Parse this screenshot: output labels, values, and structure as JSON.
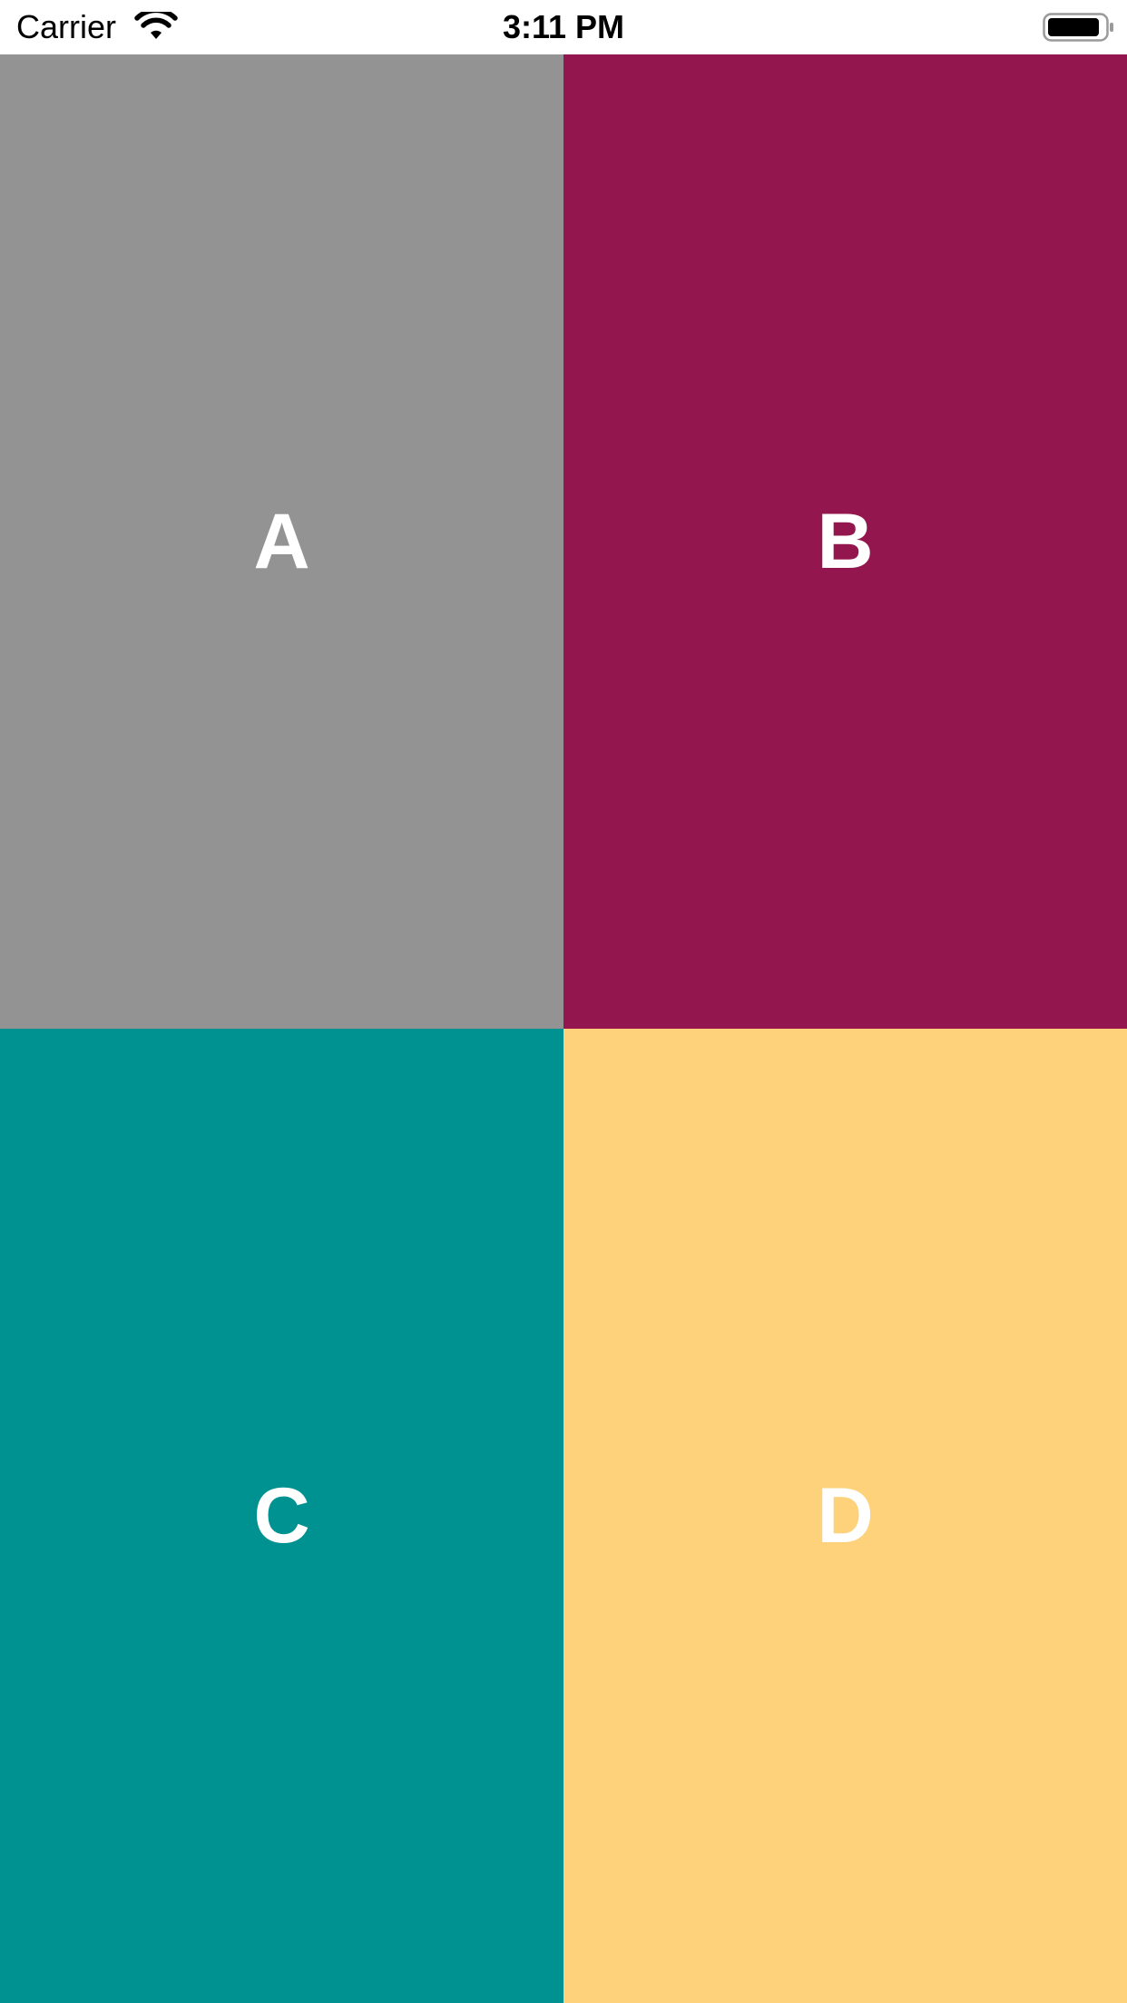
{
  "status_bar": {
    "carrier": "Carrier",
    "time": "3:11 PM",
    "wifi_icon": "wifi-icon",
    "battery_icon": "battery-icon",
    "battery_level": 0.9
  },
  "tiles": [
    {
      "label": "A",
      "color": "#939393"
    },
    {
      "label": "B",
      "color": "#94164F"
    },
    {
      "label": "C",
      "color": "#009191"
    },
    {
      "label": "D",
      "color": "#FDD27B"
    }
  ]
}
